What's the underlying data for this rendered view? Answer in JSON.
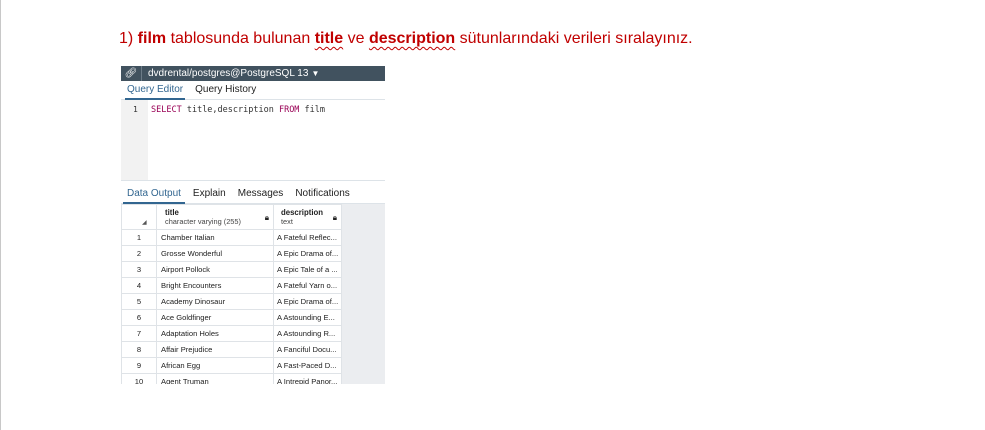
{
  "instruction": {
    "prefix": "1) ",
    "table_name": "film",
    "middle1": " tablosunda bulunan ",
    "col1": "title",
    "middle2": " ve ",
    "col2": "description",
    "suffix": " sütunlarındaki verileri sıralayınız."
  },
  "toolbar": {
    "icon": "link-icon",
    "connection": "dvdrental/postgres@PostgreSQL 13"
  },
  "editor_tabs": [
    "Query Editor",
    "Query History"
  ],
  "editor": {
    "line_number": "1",
    "keyword_select": "SELECT",
    "columns": " title,description ",
    "keyword_from": "FROM",
    "table": " film"
  },
  "output_tabs": [
    "Data Output",
    "Explain",
    "Messages",
    "Notifications"
  ],
  "grid": {
    "columns": [
      {
        "name": "title",
        "type": "character varying (255)"
      },
      {
        "name": "description",
        "type": "text"
      }
    ],
    "rows": [
      {
        "n": "1",
        "title": "Chamber Italian",
        "description": "A Fateful Reflec..."
      },
      {
        "n": "2",
        "title": "Grosse Wonderful",
        "description": "A Epic Drama of..."
      },
      {
        "n": "3",
        "title": "Airport Pollock",
        "description": "A Epic Tale of a ..."
      },
      {
        "n": "4",
        "title": "Bright Encounters",
        "description": "A Fateful Yarn o..."
      },
      {
        "n": "5",
        "title": "Academy Dinosaur",
        "description": "A Epic Drama of..."
      },
      {
        "n": "6",
        "title": "Ace Goldfinger",
        "description": "A Astounding E..."
      },
      {
        "n": "7",
        "title": "Adaptation Holes",
        "description": "A Astounding R..."
      },
      {
        "n": "8",
        "title": "Affair Prejudice",
        "description": "A Fanciful Docu..."
      },
      {
        "n": "9",
        "title": "African Egg",
        "description": "A Fast-Paced D..."
      },
      {
        "n": "10",
        "title": "Agent Truman",
        "description": "A Intrepid Panor..."
      }
    ]
  }
}
